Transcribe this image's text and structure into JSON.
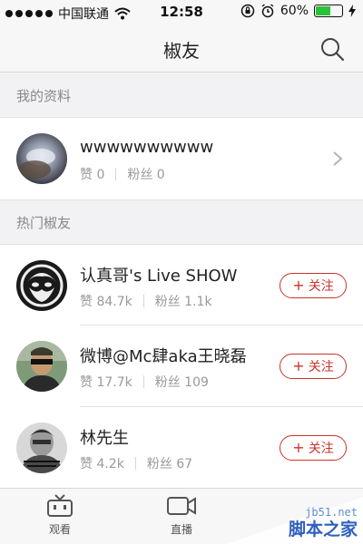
{
  "status_bar": {
    "carrier": "中国联通",
    "time": "12:58",
    "battery_percent": "60%",
    "battery_level": 0.6
  },
  "nav": {
    "title": "椒友",
    "search_icon": "search-icon"
  },
  "my_profile": {
    "section_label": "我的资料",
    "name": "wwwwwwwwww",
    "likes": "赞 0",
    "fans": "粉丝 0"
  },
  "hot": {
    "section_label": "热门椒友",
    "users": [
      {
        "name": "认真哥's Live SHOW",
        "likes": "赞 84.7k",
        "fans": "粉丝 1.1k",
        "follow_label": "关注"
      },
      {
        "name": "微博@Mc肆aka王晓磊",
        "likes": "赞 17.7k",
        "fans": "粉丝 109",
        "follow_label": "关注"
      },
      {
        "name": "林先生",
        "likes": "赞 4.2k",
        "fans": "粉丝 67",
        "follow_label": "关注"
      }
    ]
  },
  "tabs": [
    {
      "label": "观看",
      "icon": "tv-icon"
    },
    {
      "label": "直播",
      "icon": "video-camera-icon"
    }
  ],
  "watermark": {
    "url": "jb51.net",
    "name": "脚本之家"
  },
  "colors": {
    "accent": "#c9332b",
    "battery": "#2bc23b",
    "watermark": "#2f5fbd"
  }
}
